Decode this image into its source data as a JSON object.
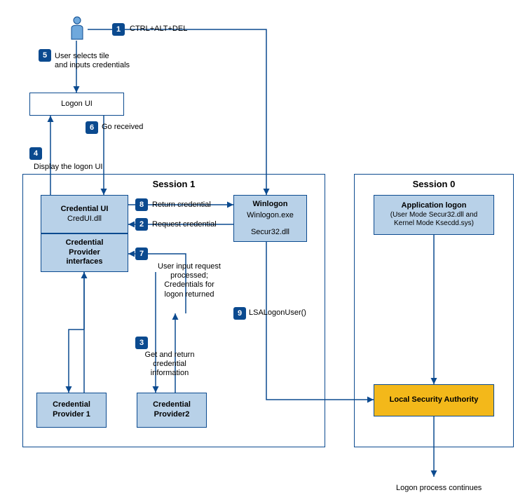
{
  "steps": {
    "s1": "1",
    "s2": "2",
    "s3": "3",
    "s4": "4",
    "s5": "5",
    "s6": "6",
    "s7": "7",
    "s8": "8",
    "s9": "9"
  },
  "labels": {
    "ctrl_alt_del": "CTRL+ALT+DEL",
    "user_selects": "User selects tile\nand inputs credentials",
    "go_received": "Go received",
    "display_logon_ui": "Display the logon UI",
    "return_credential": "Return credential",
    "request_credential": "Request credential",
    "user_input_processed": "User input request\nprocessed;\nCredentials for\nlogon returned",
    "get_return_cred": "Get and return\ncredential\ninformation",
    "lsa_logon_user": "LSALogonUser()",
    "logon_continues": "Logon process continues"
  },
  "boxes": {
    "logon_ui": "Logon UI",
    "session1": "Session 1",
    "session0": "Session 0",
    "credential_ui_title": "Credential UI",
    "credential_ui_sub": "CredUI.dll",
    "cred_provider_if": "Credential\nProvider\ninterfaces",
    "cred_provider1": "Credential\nProvider 1",
    "cred_provider2": "Credential\nProvider2",
    "winlogon_title": "Winlogon",
    "winlogon_sub1": "Winlogon.exe",
    "winlogon_sub2": "Secur32.dll",
    "app_logon_title": "Application logon",
    "app_logon_sub": "(User Mode Secur32.dll and\nKernel Mode Ksecdd.sys)",
    "lsa": "Local Security Authority"
  }
}
